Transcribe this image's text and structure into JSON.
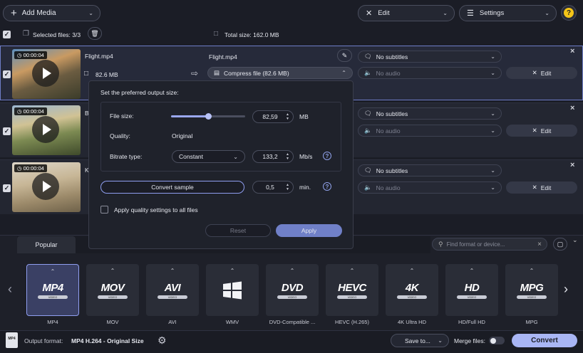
{
  "toolbar": {
    "add_media": "Add Media",
    "edit": "Edit",
    "settings": "Settings",
    "help": "?"
  },
  "selection": {
    "selected_files": "Selected files: 3/3",
    "total_size": "Total size: 162.0 MB"
  },
  "files": [
    {
      "duration": "00:00:04",
      "name": "Flight.mp4",
      "size": "82.6 MB",
      "output_name": "Flight.mp4",
      "compress": "Compress file (82.6 MB)",
      "subtitles": "No subtitles",
      "audio": "No audio",
      "edit": "Edit"
    },
    {
      "duration": "00:00:04",
      "name": "B",
      "subtitles": "No subtitles",
      "audio": "No audio",
      "edit": "Edit"
    },
    {
      "duration": "00:00:04",
      "name": "K",
      "subtitles": "No subtitles",
      "audio": "No audio",
      "edit": "Edit"
    }
  ],
  "popup": {
    "title": "Set the preferred output size:",
    "file_size_label": "File size:",
    "file_size_value": "82,59",
    "file_size_unit": "MB",
    "file_size_slider": 0.5,
    "quality_label": "Quality:",
    "quality_value": "Original",
    "bitrate_label": "Bitrate type:",
    "bitrate_type": "Constant",
    "bitrate_value": "133,2",
    "bitrate_unit": "Mb/s",
    "convert_sample": "Convert sample",
    "sample_value": "0,5",
    "sample_unit": "min.",
    "apply_all": "Apply quality settings to all files",
    "reset": "Reset",
    "apply": "Apply"
  },
  "formats": {
    "tab_popular": "Popular",
    "search_placeholder": "Find format or device...",
    "items": [
      {
        "logo": "MP4",
        "sub": "VIDEO",
        "label": "MP4"
      },
      {
        "logo": "MOV",
        "sub": "VIDEO",
        "label": "MOV"
      },
      {
        "logo": "AVI",
        "sub": "VIDEO",
        "label": "AVI"
      },
      {
        "logo": "",
        "sub": "",
        "label": "WMV"
      },
      {
        "logo": "DVD",
        "sub": "VIDEO",
        "label": "DVD-Compatible ..."
      },
      {
        "logo": "HEVC",
        "sub": "VIDEO",
        "label": "HEVC (H.265)"
      },
      {
        "logo": "4K",
        "sub": "VIDEO",
        "label": "4K Ultra HD"
      },
      {
        "logo": "HD",
        "sub": "VIDEO",
        "label": "HD/Full HD"
      },
      {
        "logo": "MPG",
        "sub": "VIDEO",
        "label": "MPG"
      }
    ]
  },
  "footer": {
    "output_format_label": "Output format:",
    "output_format_value": "MP4 H.264 - Original Size",
    "save_to": "Save to...",
    "merge_files": "Merge files:",
    "convert": "Convert"
  },
  "colors": {
    "accent": "#8f9ef0",
    "convert_bg": "#a9b6f5",
    "help": "#f5c518"
  }
}
